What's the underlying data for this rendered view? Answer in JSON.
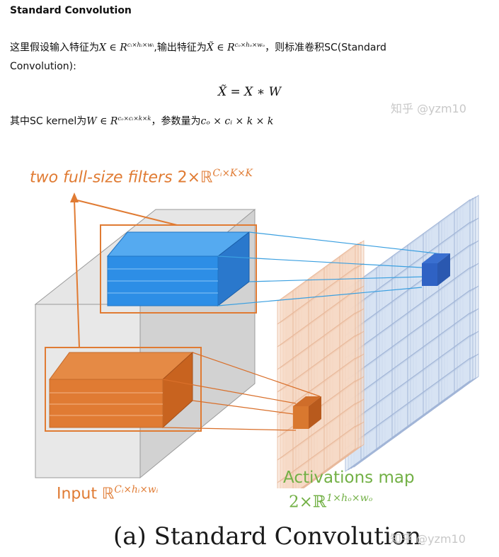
{
  "heading": "Standard Convolution",
  "para1": {
    "prefix": "这里假设输入特征为",
    "input_math": "X ∈ R",
    "input_sup": "cᵢ×hᵢ×wᵢ",
    "middle": ",输出特征为",
    "output_math": "X̃ ∈ R",
    "output_sup": "cₒ×hₒ×wₒ",
    "suffix": "，则标准卷积SC(Standard"
  },
  "para2": "Convolution):",
  "equation": "X̃ = X ∗ W",
  "para3": {
    "prefix": "其中SC kernel为",
    "kernel_math": "W ∈ R",
    "kernel_sup": "cₒ×cᵢ×k×k",
    "middle": "，参数量为",
    "params_math": "cₒ × cᵢ × k × k"
  },
  "watermark": "知乎 @yzm10",
  "figure": {
    "filters_label_italic": "two full-size filters",
    "filters_label_dim": "2×ℝ",
    "filters_label_sup": "Cᵢ×K×K",
    "input_label": "Input ℝ",
    "input_label_sup": "Cᵢ×hᵢ×wᵢ",
    "activations_label": "Activations map",
    "activations_dim": "2×ℝ",
    "activations_sup": "1×hₒ×wₒ",
    "caption": "(a) Standard Convolution"
  },
  "colors": {
    "orange": "#e07b33",
    "blue": "#2d8ee6",
    "green": "#72b045",
    "grid_orange": "#f6d9c4",
    "grid_blue": "#d6e2f3"
  }
}
